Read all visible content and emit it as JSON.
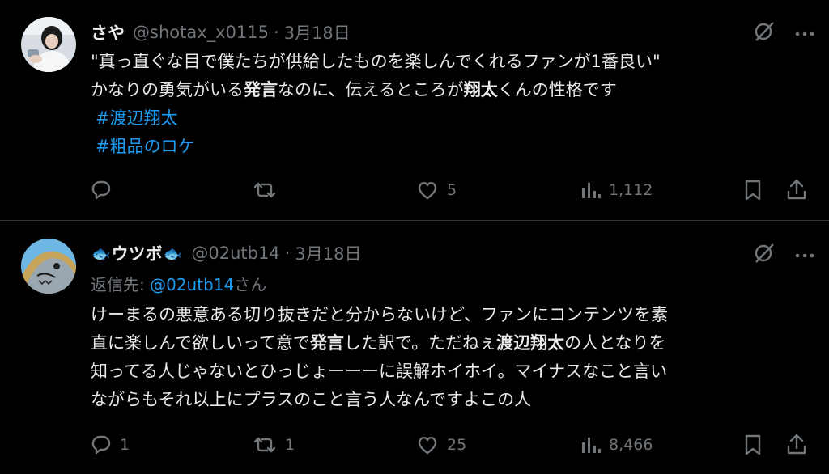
{
  "tweets": [
    {
      "author": {
        "name": "さや",
        "handle": "@shotax_x0115"
      },
      "date": "3月18日",
      "separator": "·",
      "text": {
        "l1": "\"真っ直ぐな目で僕たちが供給したものを楽しんでくれるファンが1番良い\"",
        "l2a": "かなりの勇気がいる",
        "l2b": "発言",
        "l2c": "なのに、伝えるところが",
        "l2d": "翔太",
        "l2e": "くんの性格です"
      },
      "hashtags": [
        "#渡辺翔太",
        "#粗品のロケ"
      ],
      "stats": {
        "replies": "",
        "retweets": "",
        "likes": "5",
        "views": "1,112"
      }
    },
    {
      "author": {
        "name": "ウツボ",
        "handle": "@02utb14",
        "emoji": "🐟"
      },
      "date": "3月18日",
      "separator": "·",
      "reply_prefix": "返信先: ",
      "reply_mention": "@02utb14",
      "reply_suffix": "さん",
      "text": {
        "l1": "けーまるの悪意ある切り抜きだと分からないけど、ファンにコンテンツを素",
        "l2a": "直に楽しんで欲しいって意で",
        "l2b": "発言",
        "l2c": "した訳で。ただねぇ",
        "l2d": "渡辺翔太",
        "l2e": "の人となりを",
        "l3": "知ってる人じゃないとひっじょーーーに誤解ホイホイ。マイナスなこと言い",
        "l4": "ながらもそれ以上にプラスのこと言う人なんですよこの人"
      },
      "stats": {
        "replies": "1",
        "retweets": "1",
        "likes": "25",
        "views": "8,466"
      }
    }
  ],
  "colors": {
    "background": "#000000",
    "text": "#e7e9ea",
    "muted": "#71767b",
    "link": "#1d9bf0",
    "divider": "#2f3336"
  },
  "icons": [
    "reply-icon",
    "retweet-icon",
    "like-icon",
    "views-icon",
    "bookmark-icon",
    "share-icon",
    "grok-icon",
    "more-icon"
  ]
}
